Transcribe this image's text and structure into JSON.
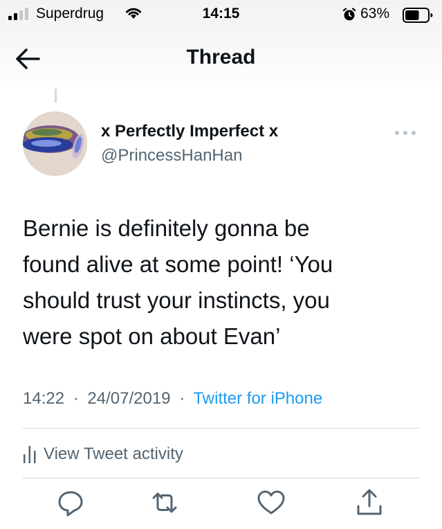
{
  "status_bar": {
    "carrier": "Superdrug",
    "time": "14:15",
    "battery_percent": "63%",
    "signal_bars_filled": 2,
    "signal_bars_total": 4,
    "battery_level": 0.63,
    "icons": [
      "signal-icon",
      "wifi-icon",
      "alarm-icon",
      "battery-icon"
    ]
  },
  "header": {
    "title": "Thread",
    "back_icon": "back-arrow-icon"
  },
  "tweet": {
    "display_name": "x Perfectly Imperfect x",
    "handle": "@PrincessHanHan",
    "text_lines": [
      "Bernie is definitely gonna be",
      "found alive at some point! ‘You",
      "should trust your instincts, you",
      "were spot on about Evan’"
    ],
    "time": "14:22",
    "separator": "·",
    "date": "24/07/2019",
    "source": "Twitter for iPhone",
    "activity_label": "View Tweet activity",
    "more_icon": "more-dots-icon"
  },
  "actions": [
    "reply-icon",
    "retweet-icon",
    "like-icon",
    "share-icon"
  ],
  "colors": {
    "text_primary": "#0f1419",
    "text_secondary": "#536471",
    "accent": "#1d9bf0",
    "divider": "#cfd9de"
  }
}
